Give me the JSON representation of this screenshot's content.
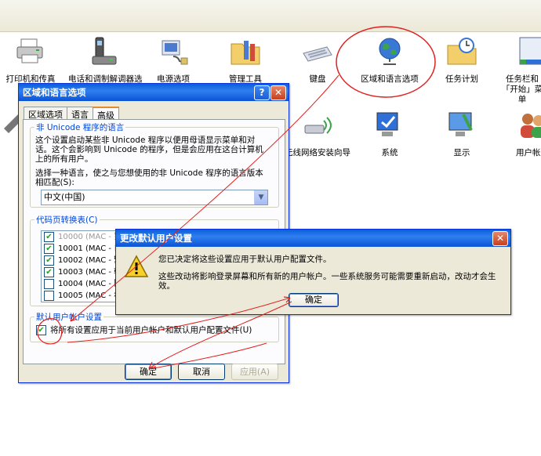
{
  "control_panel": {
    "icons": [
      {
        "label": "打印机和传真",
        "icon": "printer-icon"
      },
      {
        "label": "电话和调制解调器选",
        "icon": "phone-modem-icon"
      },
      {
        "label": "电源选项",
        "icon": "power-options-icon"
      },
      {
        "label": "管理工具",
        "icon": "admin-tools-icon"
      },
      {
        "label": "键盘",
        "icon": "keyboard-icon"
      },
      {
        "label": "区域和语言选项",
        "icon": "globe-icon"
      },
      {
        "label": "任务计划",
        "icon": "scheduled-tasks-icon"
      },
      {
        "label": "任务栏和「开始」菜单",
        "icon": "taskbar-icon"
      },
      {
        "label": "无线网络安装向导",
        "icon": "wireless-icon"
      },
      {
        "label": "系统",
        "icon": "system-icon"
      },
      {
        "label": "显示",
        "icon": "display-icon"
      },
      {
        "label": "用户帐户",
        "icon": "user-accounts-icon"
      }
    ]
  },
  "region_dialog": {
    "title": "区域和语言选项",
    "tabs": [
      "区域选项",
      "语言",
      "高级"
    ],
    "active_tab": 2,
    "unicode_group": {
      "legend": "非 Unicode 程序的语言",
      "description": [
        "这个设置启动某些非 Unicode 程序以便用母语显示菜单和对",
        "话。这个会影响到 Unicode 的程序，但是会应用在这台计算机",
        "上的所有用户。"
      ],
      "select_prompt": [
        "选择一种语言，使之与您想使用的非 Unicode 程序的语言版本",
        "相匹配(S):"
      ],
      "selected_language": "中文(中国)"
    },
    "codepage_group": {
      "legend": "代码页转换表(C)",
      "rows": [
        {
          "code": "10000",
          "desc": "(MAC - 罗",
          "checked": true,
          "grayed": true
        },
        {
          "code": "10001",
          "desc": "(MAC - 日",
          "checked": true,
          "grayed": false
        },
        {
          "code": "10002",
          "desc": "(MAC - 繁",
          "checked": true,
          "grayed": false
        },
        {
          "code": "10003",
          "desc": "(MAC - 韩",
          "checked": true,
          "grayed": false
        },
        {
          "code": "10004",
          "desc": "(MAC - 阿",
          "checked": false,
          "grayed": false
        },
        {
          "code": "10005",
          "desc": "(MAC - 希",
          "checked": false,
          "grayed": false
        }
      ]
    },
    "default_group": {
      "legend": "默认用户帐户设置",
      "checkbox_label": "将所有设置应用于当前用户帐户和默认用户配置文件(U)",
      "checked": true
    },
    "buttons": {
      "ok": "确定",
      "cancel": "取消",
      "apply": "应用(A)"
    }
  },
  "confirm_dialog": {
    "title": "更改默认用户设置",
    "message1": "您已决定将这些设置应用于默认用户配置文件。",
    "message2": "这些改动将影响登录屏幕和所有新的用户帐户。一些系统服务可能需要重新启动，改动才会生效。",
    "ok": "确定",
    "icon": "warning-icon"
  },
  "annotation_color": "#e0201e"
}
